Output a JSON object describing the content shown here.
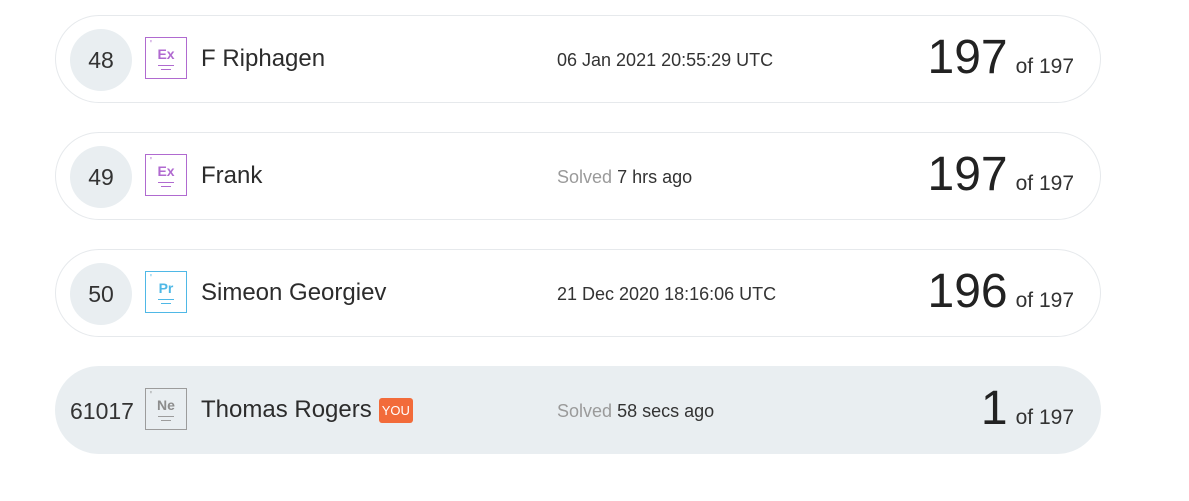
{
  "rows": [
    {
      "rank": "48",
      "badge": {
        "symbol": "Ex",
        "tick": "'"
      },
      "name": "F Riphagen",
      "solved_prefix": "",
      "solved_value": "06 Jan 2021 20:55:29 UTC",
      "score": "197",
      "total": "of 197"
    },
    {
      "rank": "49",
      "badge": {
        "symbol": "Ex",
        "tick": "'"
      },
      "name": "Frank",
      "solved_prefix": "Solved",
      "solved_value": "7 hrs ago",
      "score": "197",
      "total": "of 197"
    },
    {
      "rank": "50",
      "badge": {
        "symbol": "Pr",
        "tick": "'"
      },
      "name": "Simeon Georgiev",
      "solved_prefix": "",
      "solved_value": "21 Dec 2020 18:16:06 UTC",
      "score": "196",
      "total": "of 197"
    },
    {
      "rank": "61017",
      "badge": {
        "symbol": "Ne",
        "tick": "'"
      },
      "name": "Thomas Rogers",
      "you_tag": "YOU",
      "solved_prefix": "Solved",
      "solved_value": "58 secs ago",
      "score": "1",
      "total": "of 197"
    }
  ],
  "colors": {
    "expert_badge": "#b06ad0",
    "proficient_badge": "#4fb8e6",
    "newbie_badge": "#9c9c9c",
    "you_tag_bg": "#f26b3a",
    "current_user_row_bg": "#e9eef1"
  }
}
